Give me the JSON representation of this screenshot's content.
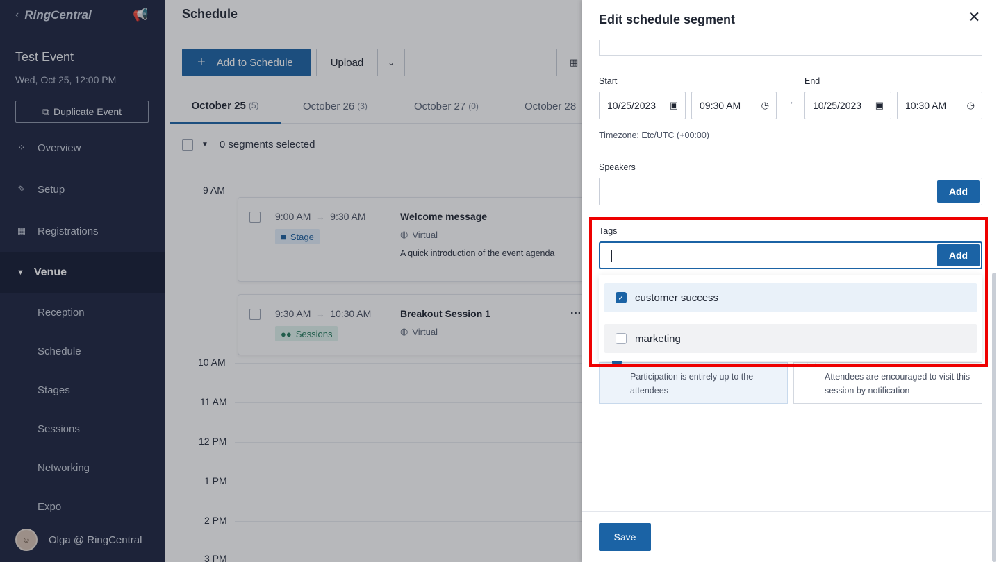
{
  "sidebar": {
    "brand": "RingCentral",
    "event_title": "Test Event",
    "event_date": "Wed, Oct 25, 12:00 PM",
    "duplicate_label": "Duplicate Event",
    "nav": {
      "overview": "Overview",
      "setup": "Setup",
      "registrations": "Registrations",
      "venue": "Venue"
    },
    "venue_items": [
      "Reception",
      "Schedule",
      "Stages",
      "Sessions",
      "Networking",
      "Expo"
    ],
    "user": "Olga @ RingCentral"
  },
  "main": {
    "title": "Schedule",
    "add_label": "Add to Schedule",
    "upload_label": "Upload",
    "tabs": [
      {
        "label": "October 25",
        "count": "(5)"
      },
      {
        "label": "October 26",
        "count": "(3)"
      },
      {
        "label": "October 27",
        "count": "(0)"
      },
      {
        "label": "October 28",
        "count": ""
      }
    ],
    "selected_text": "0 segments selected",
    "times": [
      "9 AM",
      "10 AM",
      "11 AM",
      "12 PM",
      "1 PM",
      "2 PM",
      "3 PM"
    ],
    "segments": [
      {
        "start": "9:00 AM",
        "end": "9:30 AM",
        "badge": "Stage",
        "title": "Welcome message",
        "place": "Virtual",
        "desc": "A quick introduction of the event agenda"
      },
      {
        "start": "9:30 AM",
        "end": "10:30 AM",
        "badge": "Sessions",
        "title": "Breakout Session 1",
        "place": "Virtual",
        "desc": ""
      }
    ]
  },
  "drawer": {
    "title": "Edit schedule segment",
    "start_label": "Start",
    "end_label": "End",
    "start_date": "10/25/2023",
    "start_time": "09:30 AM",
    "end_date": "10/25/2023",
    "end_time": "10:30 AM",
    "timezone": "Timezone: Etc/UTC (+00:00)",
    "speakers_label": "Speakers",
    "add_label": "Add",
    "tags_label": "Tags",
    "tags_value": "",
    "tag_options": [
      {
        "label": "customer success",
        "checked": true
      },
      {
        "label": "marketing",
        "checked": false
      }
    ],
    "participation": [
      "Participation is entirely up to the attendees",
      "Attendees are encouraged to visit this session by notification"
    ],
    "save_label": "Save"
  },
  "colors": {
    "sidebar_bg": "#1c2440",
    "accent": "#1b63a5",
    "highlight": "#ee0000"
  }
}
